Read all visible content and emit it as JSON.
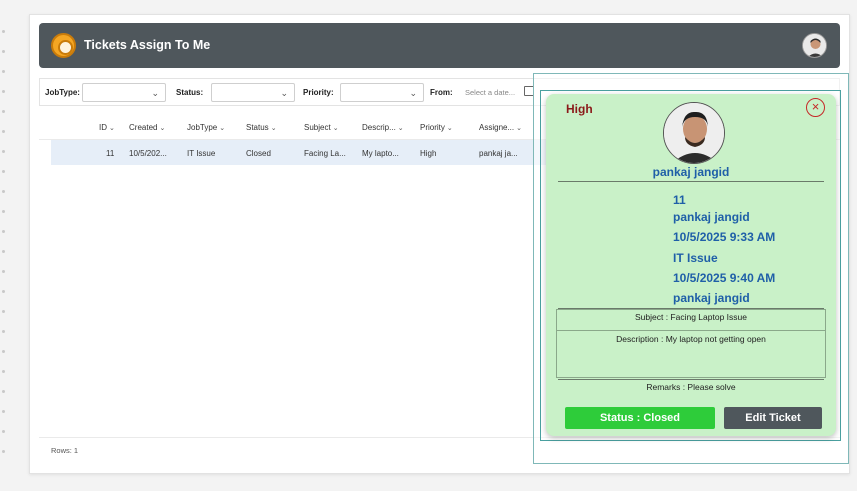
{
  "header": {
    "title": "Tickets Assign To Me"
  },
  "filters": {
    "jobtype_label": "JobType:",
    "status_label": "Status:",
    "priority_label": "Priority:",
    "from_label": "From:",
    "from_placeholder": "Select a date..."
  },
  "grid": {
    "columns": [
      "ID",
      "Created",
      "JobType",
      "Status",
      "Subject",
      "Descrip...",
      "Priority",
      "Assigne..."
    ],
    "rows": [
      [
        "11",
        "10/5/202...",
        "IT Issue",
        "Closed",
        "Facing La...",
        "My lapto...",
        "High",
        "pankaj ja..."
      ]
    ],
    "footer": "Rows: 1"
  },
  "card": {
    "priority": "High",
    "name": "pankaj jangid",
    "details": [
      "11",
      "pankaj jangid",
      "10/5/2025 9:33 AM",
      "IT Issue",
      "10/5/2025 9:40 AM",
      "pankaj jangid"
    ],
    "subject": "Subject : Facing Laptop Issue",
    "description": "Description : My laptop not getting open",
    "remarks": "Remarks : Please solve",
    "status_button": "Status : Closed",
    "edit_button": "Edit Ticket"
  },
  "icons": {
    "logo": "gear-logo-icon",
    "close": "close-circle-icon",
    "chevron": "chevron-down-icon",
    "calendar": "calendar-icon"
  },
  "colors": {
    "header_bg": "#4f575c",
    "card_bg": "#c9f1c8",
    "priority_high": "#8b1a1a",
    "link_blue": "#1f5fa8",
    "status_green": "#2ecc3a"
  }
}
